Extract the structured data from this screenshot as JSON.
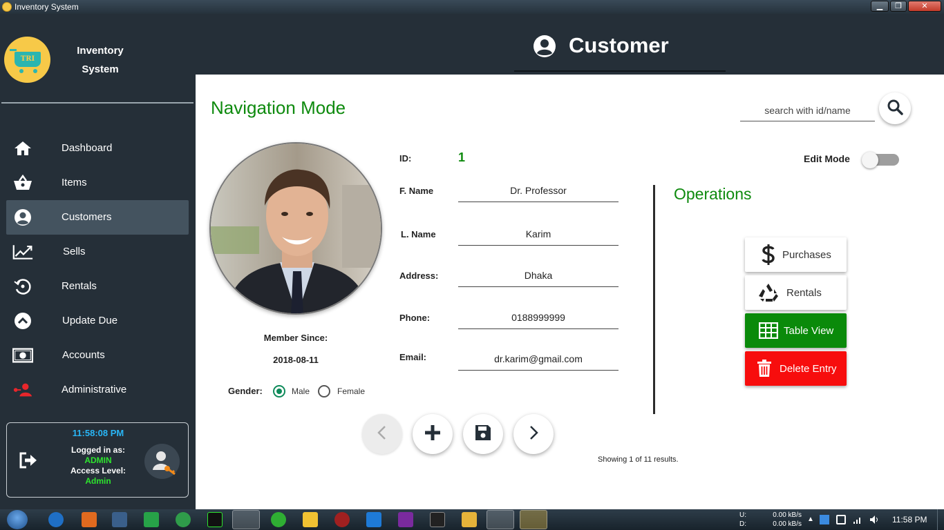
{
  "window": {
    "title": "Inventory System"
  },
  "sidebar": {
    "brand_line1": "Inventory",
    "brand_line2": "System",
    "logo_text": "TRI",
    "items": [
      {
        "label": "Dashboard",
        "icon": "home-icon"
      },
      {
        "label": "Items",
        "icon": "basket-icon"
      },
      {
        "label": "Customers",
        "icon": "account-circle-icon",
        "active": true
      },
      {
        "label": "Sells",
        "icon": "trending-up-icon"
      },
      {
        "label": "Rentals",
        "icon": "history-icon"
      },
      {
        "label": "Update Due",
        "icon": "chevron-up-circle-icon"
      },
      {
        "label": "Accounts",
        "icon": "cash-icon"
      },
      {
        "label": "Administrative",
        "icon": "admin-users-icon"
      }
    ],
    "user_panel": {
      "clock": "11:58:08 PM",
      "logged_in_label": "Logged in as:",
      "logged_in_value": "ADMIN",
      "access_level_label": "Access Level:",
      "access_level_value": "Admin"
    }
  },
  "header": {
    "title": "Customer"
  },
  "main": {
    "mode_title": "Navigation Mode",
    "search": {
      "placeholder": "search with id/name",
      "value": ""
    },
    "member_since_label": "Member Since:",
    "member_since_value": "2018-08-11",
    "gender": {
      "label": "Gender:",
      "options": [
        "Male",
        "Female"
      ],
      "selected": "Male"
    },
    "fields": {
      "id_label": "ID:",
      "id_value": "1",
      "fname_label": "F. Name",
      "fname_value": "Dr. Professor",
      "lname_label": "L. Name",
      "lname_value": "Karim",
      "address_label": "Address:",
      "address_value": "Dhaka",
      "phone_label": "Phone:",
      "phone_value": "0188999999",
      "email_label": "Email:",
      "email_value": "dr.karim@gmail.com"
    },
    "edit_mode": {
      "label": "Edit Mode",
      "on": false
    },
    "operations": {
      "title": "Operations",
      "buttons": [
        {
          "label": "Purchases",
          "icon": "dollar-icon"
        },
        {
          "label": "Rentals",
          "icon": "recycle-icon"
        },
        {
          "label": "Table View",
          "icon": "table-icon"
        },
        {
          "label": "Delete Entry",
          "icon": "trash-icon"
        }
      ]
    },
    "nav_buttons": [
      "previous-icon",
      "add-icon",
      "save-icon",
      "next-icon"
    ],
    "results_text": "Showing 1 of 11 results."
  },
  "taskbar": {
    "net_up_label": "U:",
    "net_up_value": "0.00 kB/s",
    "net_down_label": "D:",
    "net_down_value": "0.00 kB/s",
    "time": "11:58 PM"
  },
  "colors": {
    "accent_green": "#0e8a0e",
    "danger_red": "#f70d0d",
    "sidebar_bg": "#252f38",
    "active_nav": "#44535f",
    "clock_blue": "#29b6f6",
    "status_green": "#2ee52e"
  }
}
